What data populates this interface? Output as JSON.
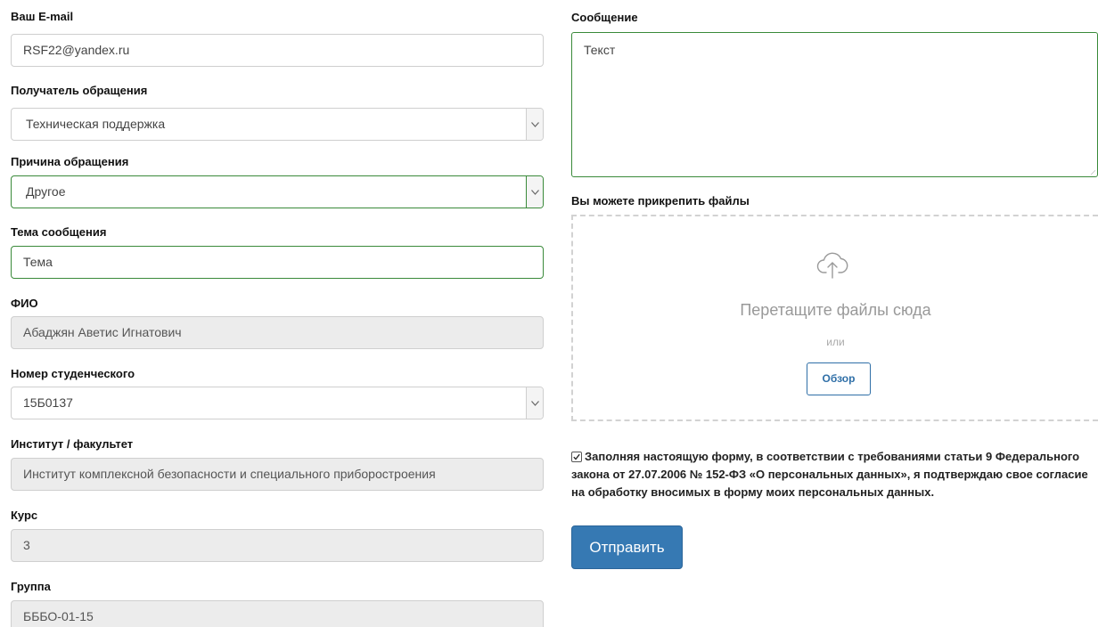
{
  "form": {
    "email": {
      "label": "Ваш E-mail",
      "value": "RSF22@yandex.ru"
    },
    "recipient": {
      "label": "Получатель обращения",
      "value": "Техническая поддержка"
    },
    "reason": {
      "label": "Причина обращения",
      "value": "Другое"
    },
    "subject": {
      "label": "Тема сообщения",
      "value": "Тема"
    },
    "fio": {
      "label": "ФИО",
      "value": "Абаджян Аветис Игнатович"
    },
    "student_number": {
      "label": "Номер студенческого",
      "value": "15Б0137"
    },
    "institute": {
      "label": "Институт / факультет",
      "value": "Институт комплексной безопасности и специального приборостроения"
    },
    "course": {
      "label": "Курс",
      "value": "3"
    },
    "group": {
      "label": "Группа",
      "value": "БББО-01-15"
    },
    "message": {
      "label": "Сообщение",
      "value": "Текст"
    },
    "attach": {
      "label": "Вы можете прикрепить файлы",
      "drop_text": "Перетащите файлы сюда",
      "or_text": "или",
      "browse_label": "Обзор",
      "icon": "cloud-upload-icon"
    },
    "consent": {
      "checked": true,
      "text": "Заполняя настоящую форму, в соответствии с требованиями статьи 9 Федерального закона от 27.07.2006 № 152-ФЗ «О персональных данных», я подтверждаю свое согласие на обработку вносимых в форму моих персональных данных."
    },
    "submit_label": "Отправить"
  },
  "colors": {
    "focus_border": "#3a8a3a",
    "primary_button": "#3679b3",
    "readonly_bg": "#ececec"
  }
}
